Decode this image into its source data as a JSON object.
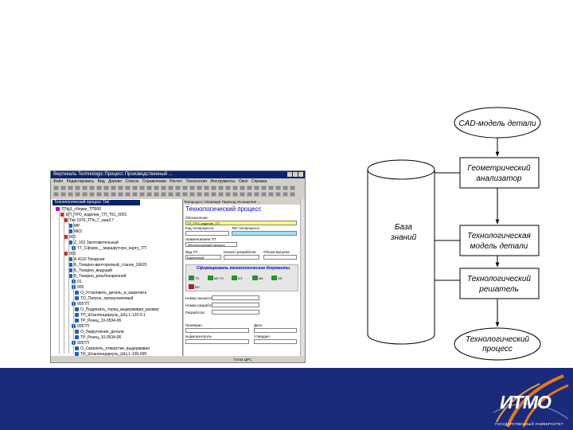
{
  "screenshot": {
    "title": "Вертикаль  Technologic  Процесс  Производственный ...",
    "menu": "Файл  Редактировать  Вид  Дерево  Список  Справочники  Расчет  Технология  Инструменты  Окно  Справка",
    "tree_header": "Технологический процесс Тип",
    "tree_rows": [
      "ТПф3_сборки_ТП000",
      "БП_ТРО_изделие_ТП_Т51_0001",
      "Тех 1970_ТПн_Г_ааа3.7",
      "МР",
      "МК2",
      "000",
      "Z_102  Заготовительный",
      "ТТ_Сформ.__маршрутную_карту_ТП",
      "005",
      "А 4110  Токарная",
      "Б_Токарно-винторезный_станок_16К20",
      "Б_Токарно_ведущий",
      "Б_Токарно_резьбонарезной",
      "01",
      "005",
      "О_Установить_деталь_и_закрепить",
      "ТО_Патрон_трехкулачковый",
      "005ТП",
      "О_Подрезать_торец_выдерживая_размер",
      "ТП_Штангенциркуль_ШЦ-1-125-0.1",
      "ТР_Резец_10-0534-06",
      "005ТП",
      "О_Закругление_детали",
      "ТР_Резец_10-0534-06",
      "005ТП",
      "О_Сверлить_отверстие_выдерживая",
      "ТИ_Штангенциркуль_ШЦ-1-100-005"
    ],
    "form": {
      "tabs": "Техпроцесс  Операция  Переход  Оснащение  ...",
      "heading": "Технологический процесс",
      "labels": [
        "Обозначение",
        "Код техпроцесса",
        "Тип техпроцесса",
        "Наименование ТП",
        "Вид ТП",
        "Начало разработки",
        "Объем выпуска",
        "Размер партии"
      ],
      "values": [
        "ТП_ТРО_изделие_ТП",
        "Технологический процесс",
        "Единичный"
      ],
      "link": "Сформировать технологические документы",
      "buttons": [
        "ТП",
        "МК ТП",
        "КЭ",
        "МК",
        "ОК",
        "ВО"
      ],
      "lower_labels": [
        "Номер процесса",
        "Номер разработки",
        "Разработал",
        "Проверил",
        "Нормоконтроль",
        "Дата",
        "Утвердил"
      ]
    },
    "status": "Готов  ЦРС"
  },
  "flowchart": {
    "database": [
      "База",
      "знаний"
    ],
    "nodes": [
      {
        "id": "cad",
        "lines": [
          "CAD-модель детали"
        ]
      },
      {
        "id": "geom",
        "lines": [
          "Геометрический",
          "анализатор"
        ]
      },
      {
        "id": "techmodel",
        "lines": [
          "Технологическая",
          "модель детали"
        ]
      },
      {
        "id": "solver",
        "lines": [
          "Технологический",
          "решатель"
        ]
      },
      {
        "id": "process",
        "lines": [
          "Технологический",
          "процесс"
        ]
      }
    ]
  },
  "footer": {
    "logo": "ИТМО",
    "logo_sub": "ГОСУДАРСТВЕННЫЙ УНИВЕРСИТЕТ",
    "color": "#1b2a7a"
  }
}
